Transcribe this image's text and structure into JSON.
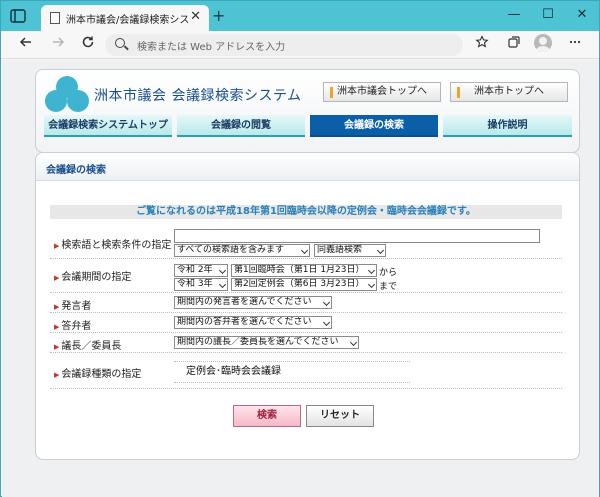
{
  "browser": {
    "tab_title": "洲本市議会/会議録検索システム",
    "tab_close": "✕",
    "new_tab": "+",
    "address_placeholder": "検索または Web アドレスを入力",
    "win_min": "—",
    "win_max": "☐",
    "win_close": "✕"
  },
  "header": {
    "site_title": "洲本市議会 会議録検索システム",
    "top_links": [
      "洲本市議会トップへ",
      "洲本市トップへ"
    ],
    "logo_color": "#3fb4d0"
  },
  "tabs": [
    {
      "label": "会議録検索システムトップ",
      "active": false
    },
    {
      "label": "会議録の閲覧",
      "active": false
    },
    {
      "label": "会議録の検索",
      "active": true
    },
    {
      "label": "操作説明",
      "active": false
    }
  ],
  "section": {
    "title": "会議録の検索",
    "notice": "ご覧になれるのは平成18年第1回臨時会以降の定例会・臨時会会議録です。"
  },
  "form": {
    "keyword": {
      "label": "検索語と検索条件の指定",
      "value": "",
      "condition": "すべての検索語を含みます",
      "mode": "同義語検索"
    },
    "period": {
      "label": "会議期間の指定",
      "from_era": "令和 2年",
      "from_session": "第1回臨時会（第1日 1月23日）",
      "from_suffix": "から",
      "to_era": "令和 3年",
      "to_session": "第2回定例会（第6日 3月23日）",
      "to_suffix": "まで"
    },
    "speaker": {
      "label": "発言者",
      "value": "期間内の発言者を選んでください"
    },
    "answerer": {
      "label": "答弁者",
      "value": "期間内の答弁者を選んでください"
    },
    "chair": {
      "label": "議長／委員長",
      "value": "期間内の議長／委員長を選んでください"
    },
    "kind": {
      "label": "会議録種類の指定",
      "value": "定例会･臨時会会議録"
    }
  },
  "actions": {
    "search": "検索",
    "reset": "リセット"
  },
  "colors": {
    "accent": "#0b5fa9",
    "tab_bar": "#4dc3d3",
    "notice_text": "#2a80b9"
  }
}
